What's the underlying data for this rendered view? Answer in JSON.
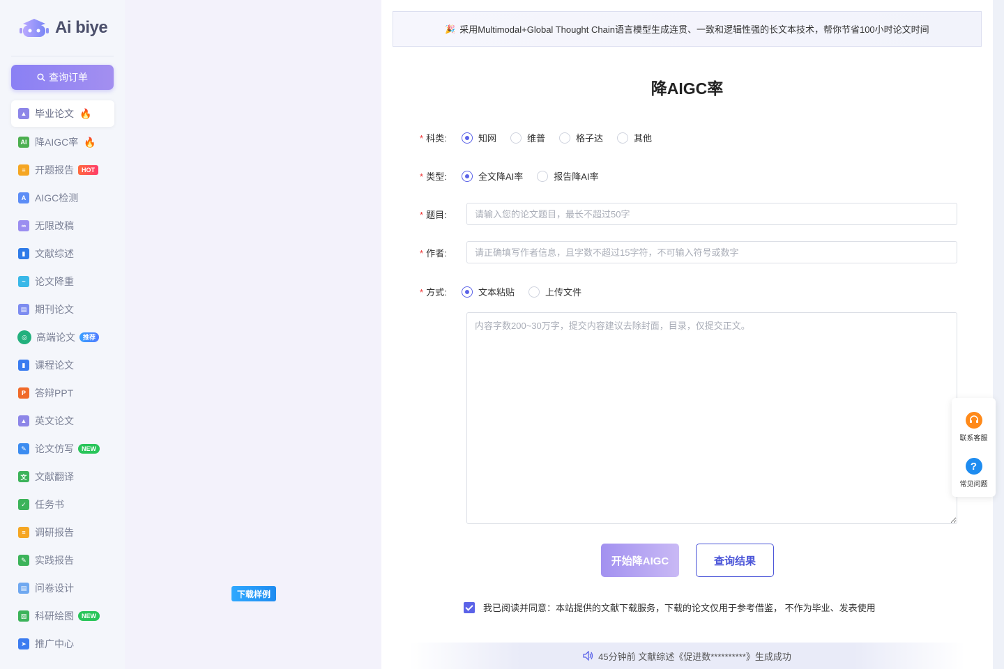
{
  "app": {
    "logo_text": "Ai biye"
  },
  "sidebar": {
    "query_order_label": "查询订单",
    "items": [
      {
        "label": "毕业论文",
        "icon": "graduation-cap-icon",
        "color": "#8d86e8",
        "badge": "fire"
      },
      {
        "label": "降AIGC率",
        "icon": "ai-shield-icon",
        "color": "#4caf50",
        "badge": "fire"
      },
      {
        "label": "开题报告",
        "icon": "report-icon",
        "color": "#f5a623",
        "badge": "HOT"
      },
      {
        "label": "AIGC检测",
        "icon": "ai-detect-icon",
        "color": "#5c8df6"
      },
      {
        "label": "无限改稿",
        "icon": "infinity-icon",
        "color": "#9b8ef0"
      },
      {
        "label": "文献综述",
        "icon": "book-icon",
        "color": "#2f7be8"
      },
      {
        "label": "论文降重",
        "icon": "chart-down-icon",
        "color": "#39b8e8"
      },
      {
        "label": "期刊论文",
        "icon": "journal-icon",
        "color": "#7d8cf0"
      },
      {
        "label": "高端论文",
        "icon": "openai-icon",
        "color": "#22b07d",
        "badge": "推荐"
      },
      {
        "label": "课程论文",
        "icon": "course-book-icon",
        "color": "#3a7cf0"
      },
      {
        "label": "答辩PPT",
        "icon": "ppt-icon",
        "color": "#f06a2a"
      },
      {
        "label": "英文论文",
        "icon": "english-cap-icon",
        "color": "#8d86e8"
      },
      {
        "label": "论文仿写",
        "icon": "pen-icon",
        "color": "#3c8cf0",
        "badge": "NEW"
      },
      {
        "label": "文献翻译",
        "icon": "translate-icon",
        "color": "#3cb35a"
      },
      {
        "label": "任务书",
        "icon": "task-icon",
        "color": "#3cb35a"
      },
      {
        "label": "调研报告",
        "icon": "survey-icon",
        "color": "#f5a623"
      },
      {
        "label": "实践报告",
        "icon": "practice-icon",
        "color": "#3cb35a"
      },
      {
        "label": "问卷设计",
        "icon": "questionnaire-icon",
        "color": "#6fa8f0"
      },
      {
        "label": "科研绘图",
        "icon": "image-icon",
        "color": "#3cb35a",
        "badge": "NEW"
      },
      {
        "label": "推广中心",
        "icon": "paper-plane-icon",
        "color": "#3c7cf0"
      }
    ]
  },
  "mid": {
    "download_sample": "下载样例"
  },
  "main": {
    "banner": "采用Multimodal+Global Thought Chain语言模型生成连贯、一致和逻辑性强的长文本技术，帮你节省100小时论文时间",
    "title": "降AIGC率",
    "form": {
      "subject_label": "科类:",
      "subject_options": [
        "知网",
        "维普",
        "格子达",
        "其他"
      ],
      "type_label": "类型:",
      "type_options": [
        "全文降AI率",
        "报告降AI率"
      ],
      "topic_label": "题目:",
      "topic_placeholder": "请输入您的论文题目，最长不超过50字",
      "author_label": "作者:",
      "author_placeholder": "请正确填写作者信息，且字数不超过15字符，不可输入符号或数字",
      "method_label": "方式:",
      "method_options": [
        "文本粘贴",
        "上传文件"
      ],
      "content_placeholder": "内容字数200~30万字，提交内容建议去除封面，目录，仅提交正文。"
    },
    "start_button": "开始降AIGC",
    "query_result_button": "查询结果",
    "agreement": "我已阅读并同意：本站提供的文献下载服务，下载的论文仅用于参考借鉴，  不作为毕业、发表使用",
    "ticker": "45分钟前 文献综述《促进数**********》生成成功"
  },
  "float": {
    "contact_label": "联系客服",
    "faq_label": "常见问题"
  },
  "colors": {
    "accent": "#5b63e8",
    "brand_gradient_start": "#8a80f4",
    "required": "#e33333"
  }
}
